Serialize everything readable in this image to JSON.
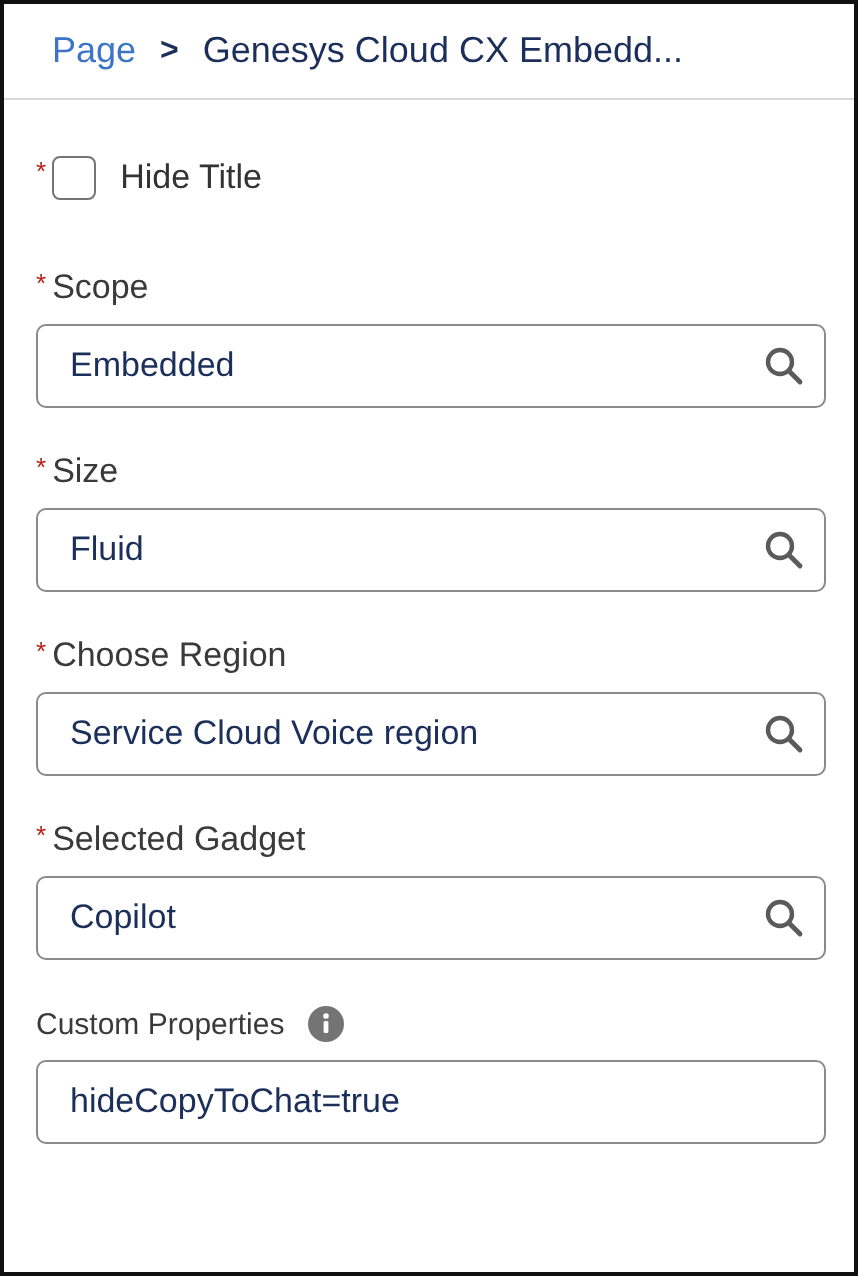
{
  "breadcrumb": {
    "items": [
      {
        "label": "Page",
        "kind": "link"
      },
      {
        "label": "Genesys Cloud CX Embedd...",
        "kind": "current"
      }
    ],
    "separator": ">"
  },
  "checkbox": {
    "required_mark": "*",
    "label": "Hide Title",
    "checked": false
  },
  "fields": [
    {
      "required_mark": "*",
      "label": "Scope",
      "value": "Embedded",
      "kind": "lookup",
      "info": false
    },
    {
      "required_mark": "*",
      "label": "Size",
      "value": "Fluid",
      "kind": "lookup",
      "info": false
    },
    {
      "required_mark": "*",
      "label": "Choose Region",
      "value": "Service Cloud Voice region",
      "kind": "lookup",
      "info": false
    },
    {
      "required_mark": "*",
      "label": "Selected Gadget",
      "value": "Copilot",
      "kind": "lookup",
      "info": false
    },
    {
      "label": "Custom Properties",
      "value": "hideCopyToChat=true",
      "kind": "text",
      "info": true
    }
  ]
}
